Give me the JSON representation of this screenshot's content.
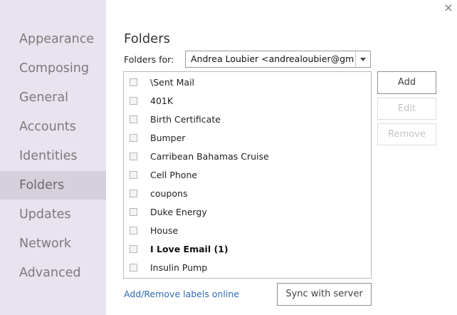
{
  "window": {
    "close_glyph": "×"
  },
  "sidebar": {
    "items": [
      {
        "label": "Appearance",
        "active": false
      },
      {
        "label": "Composing",
        "active": false
      },
      {
        "label": "General",
        "active": false
      },
      {
        "label": "Accounts",
        "active": false
      },
      {
        "label": "Identities",
        "active": false
      },
      {
        "label": "Folders",
        "active": true
      },
      {
        "label": "Updates",
        "active": false
      },
      {
        "label": "Network",
        "active": false
      },
      {
        "label": "Advanced",
        "active": false
      }
    ]
  },
  "main": {
    "title": "Folders",
    "folders_for_label": "Folders for:",
    "account_select": {
      "value": "Andrea Loubier <andrealoubier@gmail."
    },
    "folders": [
      {
        "label": "\\Sent Mail",
        "checked": false,
        "bold": false
      },
      {
        "label": "401K",
        "checked": false,
        "bold": false
      },
      {
        "label": "Birth Certificate",
        "checked": false,
        "bold": false
      },
      {
        "label": "Bumper",
        "checked": false,
        "bold": false
      },
      {
        "label": "Carribean Bahamas Cruise",
        "checked": false,
        "bold": false
      },
      {
        "label": "Cell Phone",
        "checked": false,
        "bold": false
      },
      {
        "label": "coupons",
        "checked": false,
        "bold": false
      },
      {
        "label": "Duke Energy",
        "checked": false,
        "bold": false
      },
      {
        "label": "House",
        "checked": false,
        "bold": false
      },
      {
        "label": "I Love Email (1)",
        "checked": false,
        "bold": true
      },
      {
        "label": "Insulin Pump",
        "checked": false,
        "bold": false
      }
    ],
    "buttons": {
      "add": "Add",
      "edit": "Edit",
      "remove": "Remove",
      "sync": "Sync with server"
    },
    "labels_link": "Add/Remove labels online"
  }
}
